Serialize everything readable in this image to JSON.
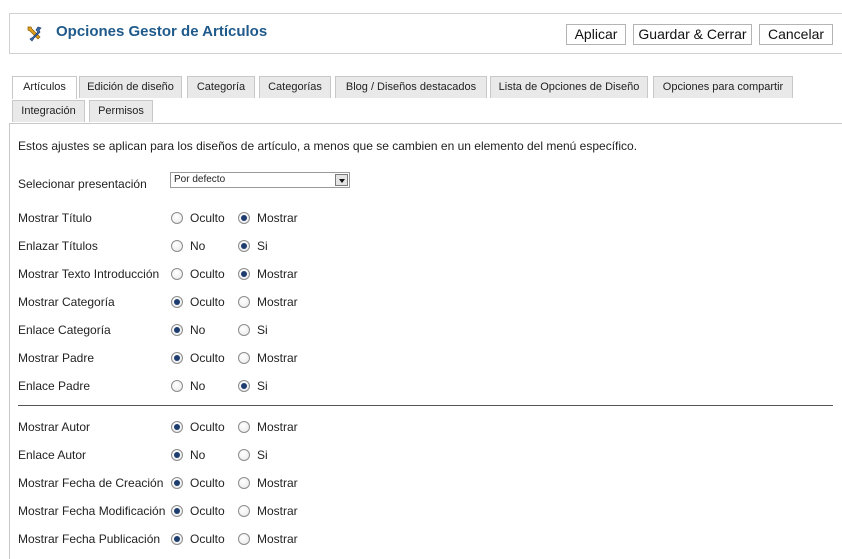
{
  "header": {
    "title": "Opciones Gestor de Artículos",
    "icon": "tools-icon",
    "buttons": {
      "apply": "Aplicar",
      "save_close": "Guardar & Cerrar",
      "cancel": "Cancelar"
    }
  },
  "tabs": [
    {
      "label": "Artículos",
      "active": true
    },
    {
      "label": "Edición de diseño",
      "active": false
    },
    {
      "label": "Categoría",
      "active": false
    },
    {
      "label": "Categorías",
      "active": false
    },
    {
      "label": "Blog / Diseños destacados",
      "active": false
    },
    {
      "label": "Lista de Opciones de Diseño",
      "active": false
    },
    {
      "label": "Opciones para compartir",
      "active": false
    },
    {
      "label": "Integración",
      "active": false
    },
    {
      "label": "Permisos",
      "active": false
    }
  ],
  "panel": {
    "description": "Estos ajustes se aplican para los diseños de artículo, a menos que se cambien en un elemento del menú específico.",
    "layout_select": {
      "label": "Selecionar presentación",
      "value": "Por defecto"
    },
    "options_a": [
      {
        "label": "Mostrar Título",
        "opt1": "Oculto",
        "opt2": "Mostrar",
        "selected": 2
      },
      {
        "label": "Enlazar Títulos",
        "opt1": "No",
        "opt2": "Si",
        "selected": 2
      },
      {
        "label": "Mostrar Texto Introducción",
        "opt1": "Oculto",
        "opt2": "Mostrar",
        "selected": 2
      },
      {
        "label": "Mostrar Categoría",
        "opt1": "Oculto",
        "opt2": "Mostrar",
        "selected": 1
      },
      {
        "label": "Enlace Categoría",
        "opt1": "No",
        "opt2": "Si",
        "selected": 1
      },
      {
        "label": "Mostrar Padre",
        "opt1": "Oculto",
        "opt2": "Mostrar",
        "selected": 1
      },
      {
        "label": "Enlace Padre",
        "opt1": "No",
        "opt2": "Si",
        "selected": 2
      }
    ],
    "options_b": [
      {
        "label": "Mostrar Autor",
        "opt1": "Oculto",
        "opt2": "Mostrar",
        "selected": 1
      },
      {
        "label": "Enlace Autor",
        "opt1": "No",
        "opt2": "Si",
        "selected": 1
      },
      {
        "label": "Mostrar Fecha de Creación",
        "opt1": "Oculto",
        "opt2": "Mostrar",
        "selected": 1
      },
      {
        "label": "Mostrar Fecha Modificación",
        "opt1": "Oculto",
        "opt2": "Mostrar",
        "selected": 1
      },
      {
        "label": "Mostrar Fecha Publicación",
        "opt1": "Oculto",
        "opt2": "Mostrar",
        "selected": 1
      }
    ]
  },
  "colors": {
    "title": "#1f5a8a",
    "radio_selected": "#1d3d6e"
  }
}
